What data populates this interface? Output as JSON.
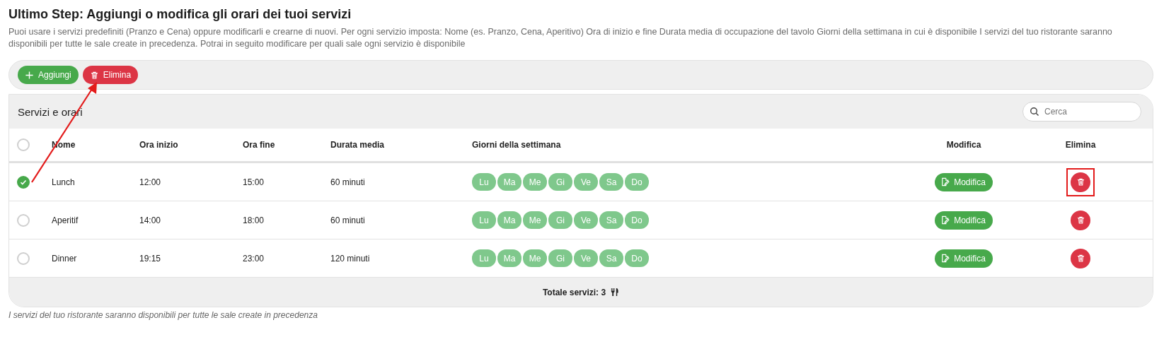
{
  "title": "Ultimo Step: Aggiungi o modifica gli orari dei tuoi servizi",
  "description": "Puoi usare i servizi predefiniti (Pranzo e Cena) oppure modificarli e crearne di nuovi. Per ogni servizio imposta: Nome (es. Pranzo, Cena, Aperitivo) Ora di inizio e fine Durata media di occupazione del tavolo Giorni della settimana in cui è disponibile I servizi del tuo ristorante saranno disponibili per tutte le sale create in precedenza. Potrai in seguito modificare per quali sale ogni servizio è disponibile",
  "toolbar": {
    "add_button": "Aggiungi",
    "delete_button": "Elimina"
  },
  "table": {
    "title": "Servizi e orari",
    "search": {
      "placeholder": "Cerca"
    },
    "select_all": {
      "selected": false
    },
    "columns": [
      "Nome",
      "Ora inizio",
      "Ora fine",
      "Durata media",
      "Giorni della settimana",
      "Modifica",
      "Elimina"
    ],
    "rows": [
      {
        "selected": true,
        "name": "Lunch",
        "start": "12:00",
        "end": "15:00",
        "duration": "60 minuti",
        "days": [
          "Lu",
          "Ma",
          "Me",
          "Gi",
          "Ve",
          "Sa",
          "Do"
        ],
        "edit": "Modifica",
        "highlighted": true
      },
      {
        "selected": false,
        "name": "Aperitif",
        "start": "14:00",
        "end": "18:00",
        "duration": "60 minuti",
        "days": [
          "Lu",
          "Ma",
          "Me",
          "Gi",
          "Ve",
          "Sa",
          "Do"
        ],
        "edit": "Modifica",
        "highlighted": false
      },
      {
        "selected": false,
        "name": "Dinner",
        "start": "19:15",
        "end": "23:00",
        "duration": "120 minuti",
        "days": [
          "Lu",
          "Ma",
          "Me",
          "Gi",
          "Ve",
          "Sa",
          "Do"
        ],
        "edit": "Modifica",
        "highlighted": false
      }
    ],
    "footer": "Totale servizi: 3"
  },
  "note": "I servizi del tuo ristorante saranno disponibili per tutte le sale create in precedenza"
}
